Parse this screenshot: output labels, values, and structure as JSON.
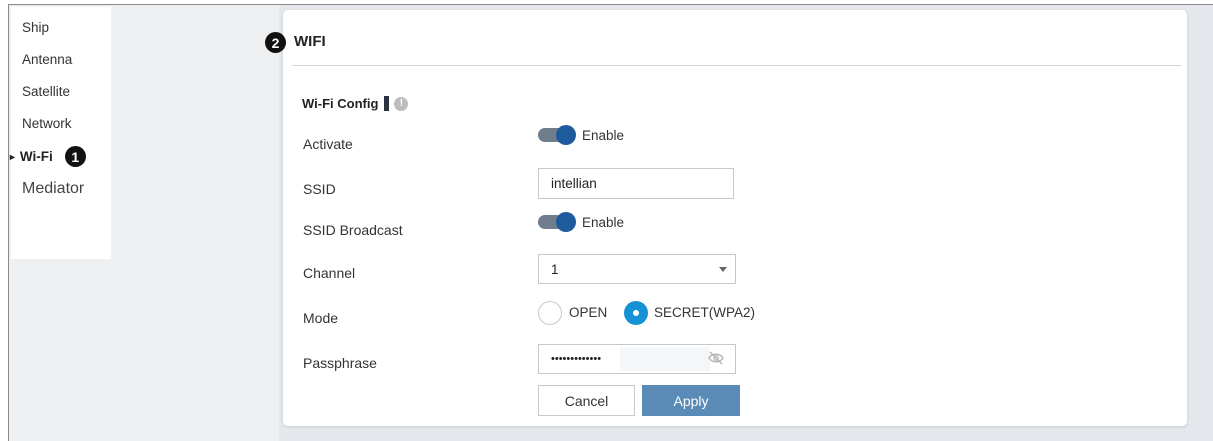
{
  "sidebar": {
    "items": [
      {
        "label": "Ship"
      },
      {
        "label": "Antenna"
      },
      {
        "label": "Satellite"
      },
      {
        "label": "Network"
      },
      {
        "label": "Wi-Fi",
        "marker": "►",
        "callout": "1"
      },
      {
        "label": "Mediator"
      }
    ]
  },
  "panel": {
    "callout": "2",
    "title": "WIFI",
    "section_title": "Wi-Fi Config",
    "info_icon": "!"
  },
  "form": {
    "activate": {
      "label": "Activate",
      "state": "Enable"
    },
    "ssid": {
      "label": "SSID",
      "value": "intellian"
    },
    "ssid_broadcast": {
      "label": "SSID Broadcast",
      "state": "Enable"
    },
    "channel": {
      "label": "Channel",
      "value": "1"
    },
    "mode": {
      "label": "Mode",
      "options": [
        "OPEN",
        "SECRET(WPA2)"
      ],
      "selected": "SECRET(WPA2)"
    },
    "passphrase": {
      "label": "Passphrase",
      "value": "•••••••••••••"
    }
  },
  "buttons": {
    "cancel": "Cancel",
    "apply": "Apply"
  },
  "colors": {
    "toggle_knob": "#1e5b9c",
    "radio_selected": "#1592d3",
    "apply_button": "#5a8ab6"
  },
  "icons": {
    "eye": "eye-slash-icon",
    "info": "info-icon",
    "caret": "chevron-down-icon"
  }
}
